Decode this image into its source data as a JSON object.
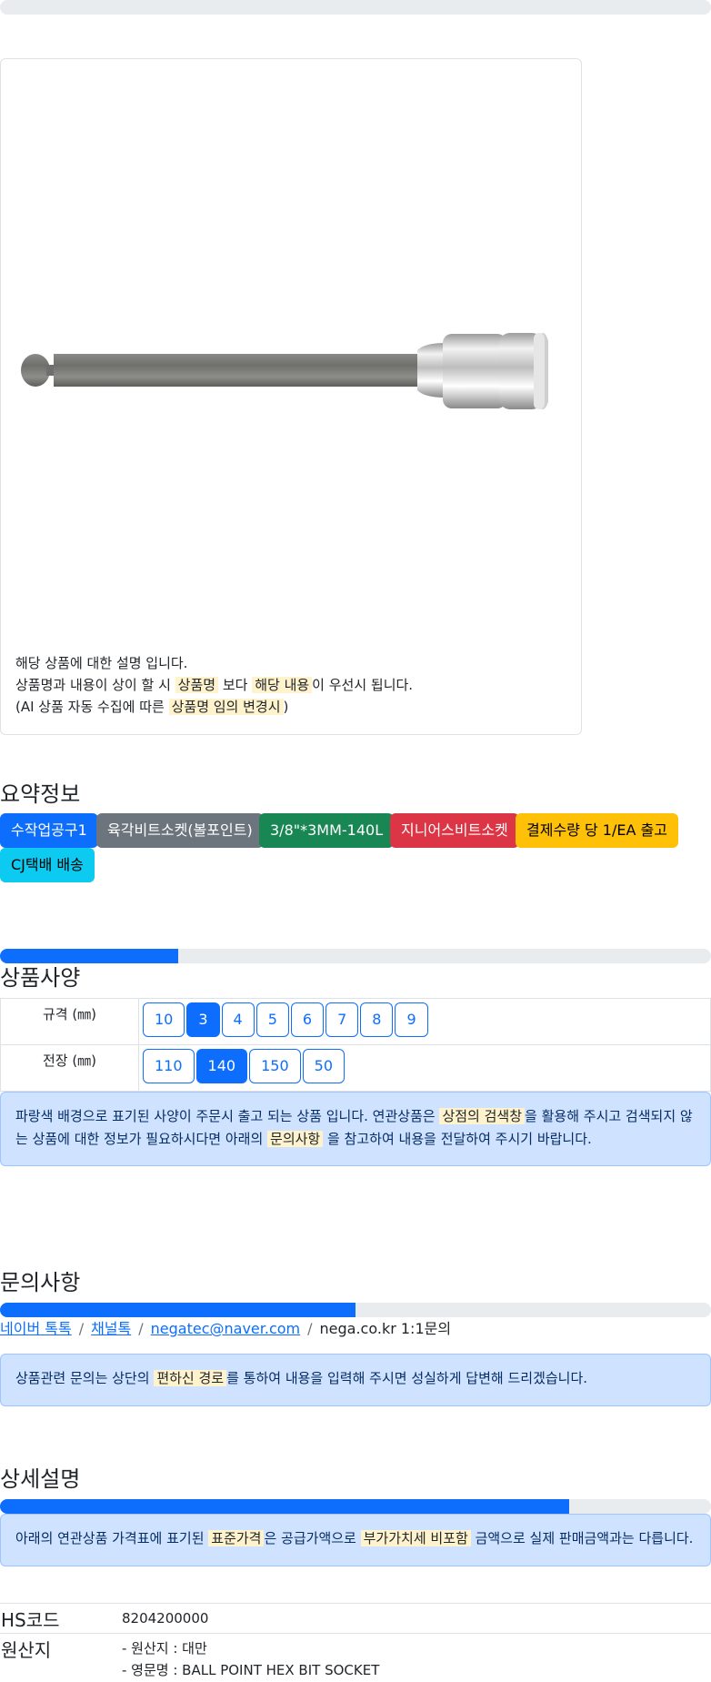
{
  "product": {
    "image_alt": "Ball point hex bit socket",
    "description_line1": "해당 상품에 대한 설명 입니다.",
    "description_line2_pre": "상품명과 내용이 상이 할 시 ",
    "description_line2_hl1": "상품명",
    "description_line2_mid": " 보다 ",
    "description_line2_hl2": "해당 내용",
    "description_line2_post": "이 우선시 됩니다.",
    "description_line3_pre": "(AI 상품 자동 수집에 따른 ",
    "description_line3_hl": "상품명 임의 변경시",
    "description_line3_post": ")"
  },
  "summary": {
    "title": "요약정보",
    "badges": [
      {
        "label": "수작업공구1",
        "color": "#0d6efd"
      },
      {
        "label": "육각비트소켓(볼포인트)",
        "color": "#6c757d"
      },
      {
        "label": "3/8\"*3MM-140L",
        "color": "#198754"
      },
      {
        "label": "지니어스비트소켓",
        "color": "#dc3545"
      },
      {
        "label": "결제수량 당 1/EA 출고",
        "color": "#ffc107"
      },
      {
        "label": "CJ택배 배송",
        "color": "#0dcaf0"
      }
    ]
  },
  "spec": {
    "title": "상품사양",
    "progress_percent": 25,
    "rows": [
      {
        "label": "규격 (㎜)",
        "options": [
          "10",
          "3",
          "4",
          "5",
          "6",
          "7",
          "8",
          "9"
        ],
        "selected": "3"
      },
      {
        "label": "전장 (㎜)",
        "options": [
          "110",
          "140",
          "150",
          "50"
        ],
        "selected": "140"
      }
    ],
    "note_pre": "파랑색 배경으로 표기된 사양이 주문시 출고 되는 상품 입니다. 연관상품은 ",
    "note_hl1": "상점의 검색창",
    "note_mid": "을 활용해 주시고 검색되지 않는 상품에 대한 정보가 필요하시다면 아래의 ",
    "note_hl2": "문의사항",
    "note_post": " 을 참고하여 내용을 전달하여 주시기 바랍니다."
  },
  "inquiry": {
    "title": "문의사항",
    "progress_percent": 50,
    "links": [
      "네이버 톡톡",
      "채널톡",
      "negatec@naver.com"
    ],
    "plain": "nega.co.kr 1:1문의",
    "note_pre": "상품관련 문의는 상단의 ",
    "note_hl": "편하신 경로",
    "note_post": "를 통하여 내용을 입력해 주시면 성실하게 답변해 드리겠습니다."
  },
  "detail": {
    "title": "상세설명",
    "progress_percent": 80,
    "note_pre": "아래의 연관상품 가격표에 표기된 ",
    "note_hl1": "표준가격",
    "note_mid": "은 공급가액으로 ",
    "note_hl2": "부가가치세 비포함",
    "note_post": " 금액으로 실제 판매금액과는 다릅니다.",
    "rows": [
      {
        "label": "HS코드",
        "lines": [
          "8204200000"
        ]
      },
      {
        "label": "원산지",
        "lines": [
          "- 원산지 : 대만",
          "- 영문명 : BALL POINT HEX BIT SOCKET"
        ]
      }
    ]
  }
}
